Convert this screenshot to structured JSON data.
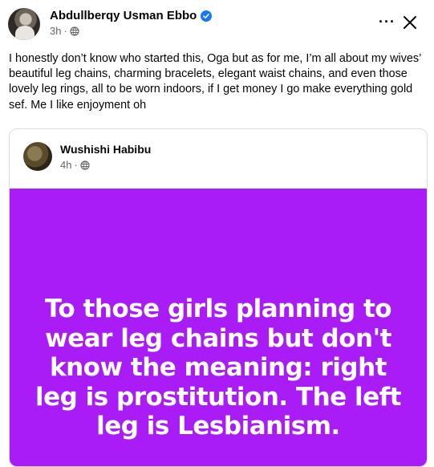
{
  "post": {
    "author": "Abdullberqy Usman Ebbo",
    "verified_icon": "verified-badge-icon",
    "time": "3h",
    "separator": "·",
    "privacy_icon": "globe-icon",
    "more_icon": "more-horizontal-icon",
    "more_label": "···",
    "close_icon": "close-icon",
    "text": "I honestly don’t know who started this, Oga but as for me, I’m all about my wives’ beautiful leg chains, charming bracelets, elegant waist chains, and even those lovely leg rings, all to be worn indoors, if I get money I go make everything gold sef. Me I like enjoyment oh"
  },
  "shared_post": {
    "author": "Wushishi Habibu",
    "time": "4h",
    "separator": "·",
    "privacy_icon": "globe-icon",
    "card_background": "#a91cf5",
    "card_text": "To those girls planning to wear leg chains but don't know the meaning: right leg is prostitution. The left leg is Lesbianism."
  },
  "colors": {
    "accent_verified": "#1877f2",
    "meta_gray": "#65676b",
    "card_purple": "#a91cf5"
  }
}
